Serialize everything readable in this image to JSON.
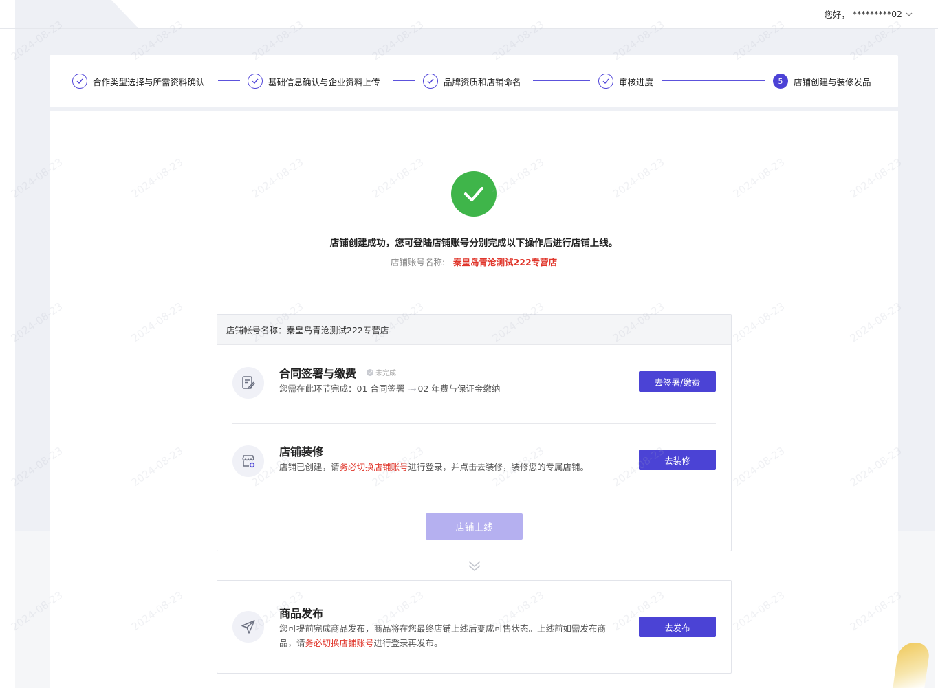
{
  "header": {
    "greeting": "您好，",
    "username": "*********02"
  },
  "steps": [
    {
      "label": "合作类型选择与所需资料确认",
      "status": "done"
    },
    {
      "label": "基础信息确认与企业资料上传",
      "status": "done"
    },
    {
      "label": "品牌资质和店铺命名",
      "status": "done"
    },
    {
      "label": "审核进度",
      "status": "done"
    },
    {
      "label": "店铺创建与装修发品",
      "status": "current",
      "number": "5"
    }
  ],
  "success": {
    "title": "店铺创建成功，您可登陆店铺账号分别完成以下操作后进行店铺上线。",
    "account_label": "店铺账号名称:",
    "account_value": "秦皇岛青沧测试222专营店"
  },
  "task_box": {
    "header": "店铺帐号名称：秦皇岛青沧测试222专营店",
    "contract": {
      "title": "合同签署与缴费",
      "status": "未完成",
      "desc_prefix": "您需在此环节完成：01 合同签署",
      "desc_arrow": "--→",
      "desc_suffix": "02 年费与保证金缴纳",
      "button": "去签署/缴费"
    },
    "decorate": {
      "title": "店铺装修",
      "desc_prefix": "店铺已创建，请",
      "desc_red": "务必切换店铺账号",
      "desc_suffix": "进行登录，并点击去装修，装修您的专属店铺。",
      "button": "去装修"
    },
    "online_button": "店铺上线"
  },
  "product": {
    "title": "商品发布",
    "desc_line1": "您可提前完成商品发布，商品将在您最终店铺上线后变成可售状态。上线前如需发布商",
    "desc_line2_prefix": "品，请",
    "desc_line2_red": "务必切换店铺账号",
    "desc_line2_suffix": "进行登录再发布。",
    "button": "去发布"
  },
  "watermark": "2024-08-23",
  "colors": {
    "accent": "#4b43d5",
    "success": "#3fb54a",
    "warning_text": "#e0362b",
    "disabled_button": "#b5b0f0"
  }
}
